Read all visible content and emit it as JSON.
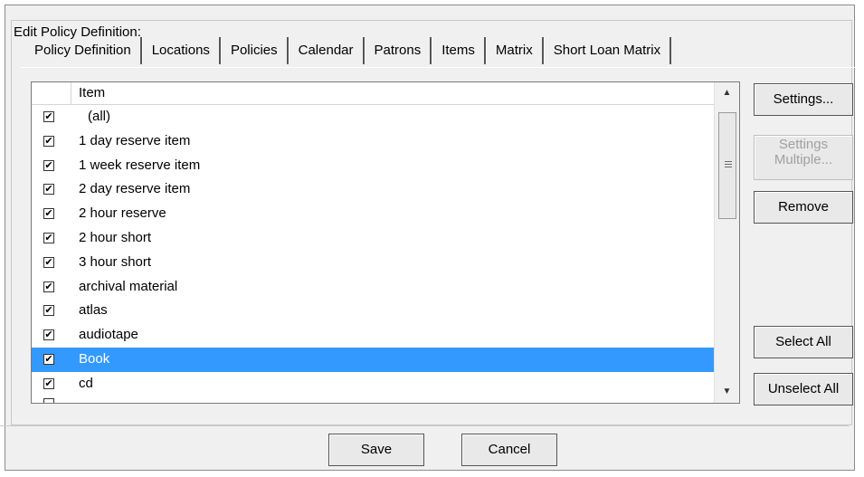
{
  "dialog": {
    "group_title": "Edit Policy Definition:"
  },
  "tabs": [
    {
      "label": "Policy Definition",
      "active": false
    },
    {
      "label": "Locations",
      "active": false
    },
    {
      "label": "Policies",
      "active": false
    },
    {
      "label": "Calendar",
      "active": false
    },
    {
      "label": "Patrons",
      "active": false
    },
    {
      "label": "Items",
      "active": true
    },
    {
      "label": "Matrix",
      "active": false
    },
    {
      "label": "Short Loan Matrix",
      "active": false
    }
  ],
  "list": {
    "column_header": "Item",
    "rows": [
      {
        "label": "(all)",
        "checked": true,
        "selected": false
      },
      {
        "label": "1 day reserve item",
        "checked": true,
        "selected": false
      },
      {
        "label": "1 week reserve item",
        "checked": true,
        "selected": false
      },
      {
        "label": "2 day reserve item",
        "checked": true,
        "selected": false
      },
      {
        "label": "2 hour reserve",
        "checked": true,
        "selected": false
      },
      {
        "label": "2 hour short",
        "checked": true,
        "selected": false
      },
      {
        "label": "3 hour short",
        "checked": true,
        "selected": false
      },
      {
        "label": "archival material",
        "checked": true,
        "selected": false
      },
      {
        "label": "atlas",
        "checked": true,
        "selected": false
      },
      {
        "label": "audiotape",
        "checked": true,
        "selected": false
      },
      {
        "label": "Book",
        "checked": true,
        "selected": true
      },
      {
        "label": "cd",
        "checked": true,
        "selected": false
      }
    ]
  },
  "side_buttons": {
    "settings": "Settings...",
    "settings_multiple_line1": "Settings",
    "settings_multiple_line2": "Multiple...",
    "remove": "Remove",
    "select_all": "Select All",
    "unselect_all": "Unselect All"
  },
  "footer": {
    "save": "Save",
    "cancel": "Cancel"
  },
  "icons": {
    "check": "✔",
    "scroll_up": "▲",
    "scroll_down": "▼"
  }
}
